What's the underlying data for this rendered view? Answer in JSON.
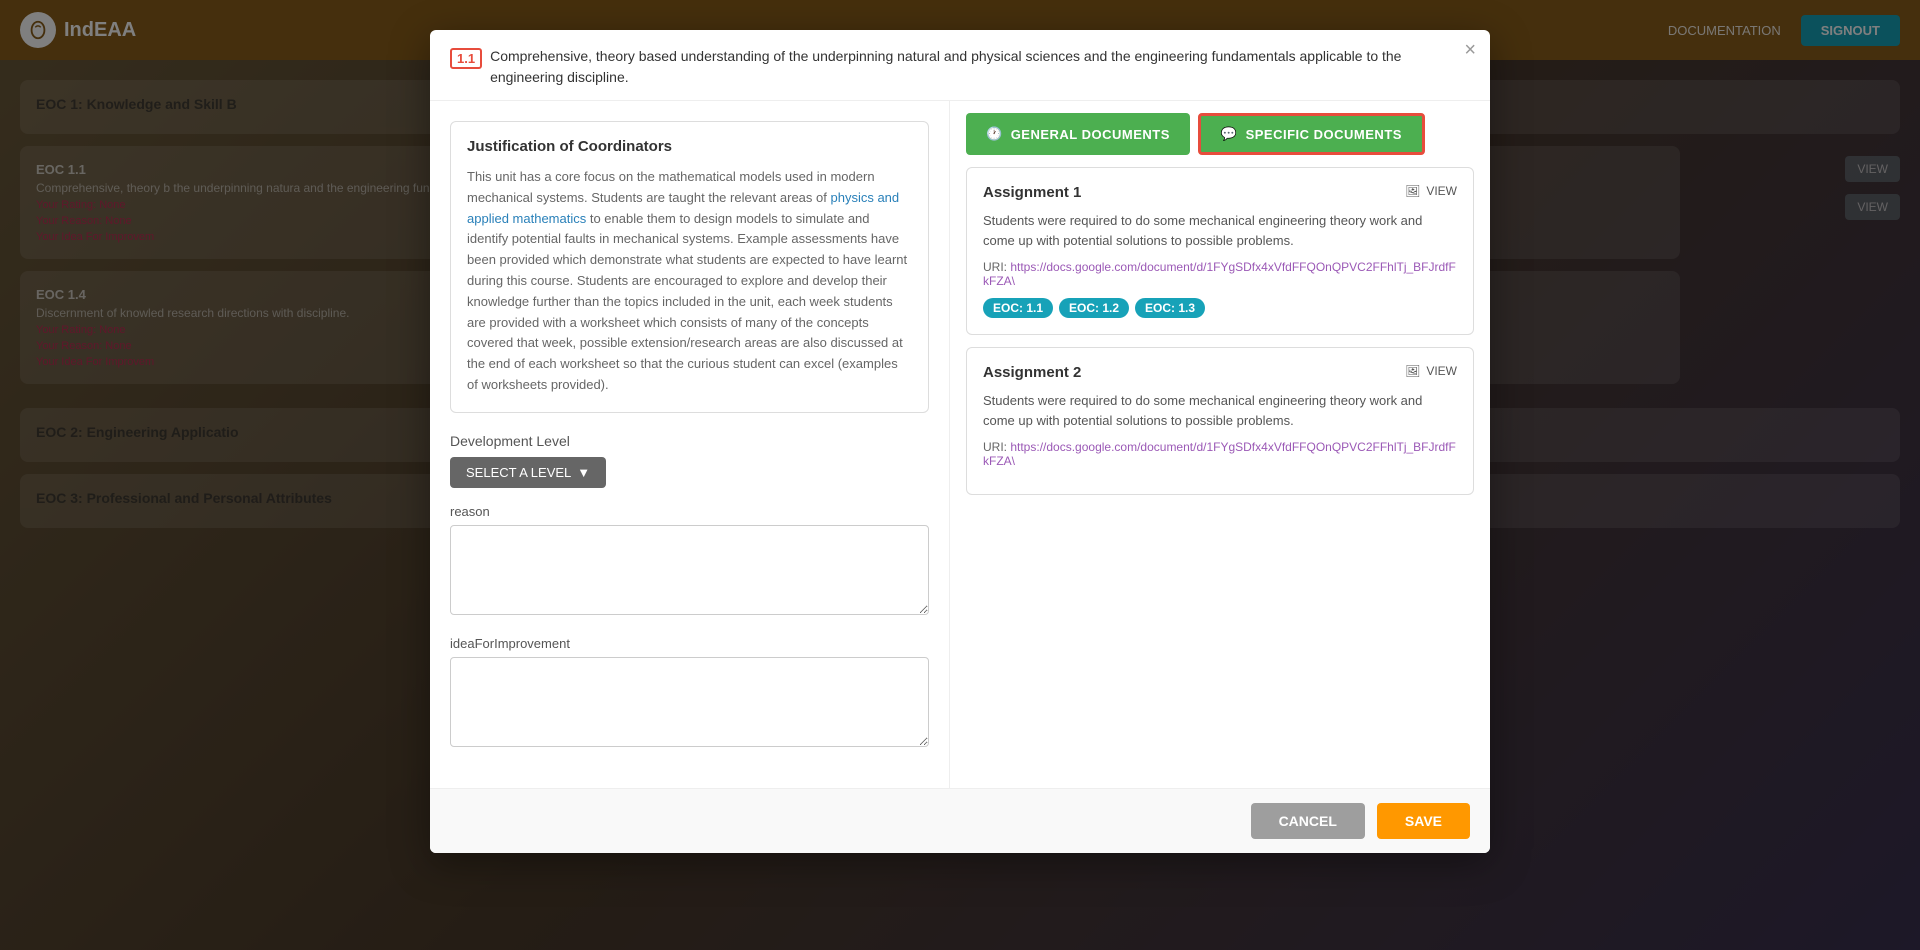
{
  "app": {
    "name": "IndEAA",
    "signout_label": "SIGNOUT",
    "documentation_label": "DOCUMENTATION"
  },
  "modal": {
    "eoc_badge": "1.1",
    "title_text": "Comprehensive, theory based understanding of the underpinning natural and physical sciences and the engineering fundamentals applicable to the engineering discipline.",
    "close_icon": "×",
    "left": {
      "justification_title": "Justification of Coordinators",
      "justification_text_1": "This unit has a core focus on the mathematical models used in modern mechanical systems. Students are taught the relevant areas of ",
      "justification_highlight_1": "physics and applied mathematics",
      "justification_text_2": " to enable them to design models to simulate and identify potential faults in mechanical systems. Example assessments have been provided which demonstrate what students are expected to have learnt during this course. Students are encouraged to explore and develop their knowledge further than the topics included in the unit, each week students are provided with a worksheet which consists of many of the concepts covered that week, possible extension/research areas are also discussed at the end of each worksheet so that the curious student can excel (examples of worksheets provided).",
      "dev_level_label": "Development Level",
      "select_level_btn": "SELECT A LEVEL",
      "reason_label": "reason",
      "idea_label": "ideaForImprovement"
    },
    "right": {
      "tab_general": "GENERAL DOCUMENTS",
      "tab_specific": "SPECIFIC DOCUMENTS",
      "assignments": [
        {
          "title": "Assignment 1",
          "view_label": "VIEW",
          "description": "Students were required to do some mechanical engineering theory work and come up with potential solutions to possible problems.",
          "uri_label": "URI:",
          "uri_text": "https://docs.google.com/document/d/1FYgSDfx4xVfdFFQOnQPVC2FFhlTj_BFJrdfFkFZA\\",
          "tags": [
            "EOC: 1.1",
            "EOC: 1.2",
            "EOC: 1.3"
          ]
        },
        {
          "title": "Assignment 2",
          "view_label": "VIEW",
          "description": "Students were required to do some mechanical engineering theory work and come up with potential solutions to possible problems.",
          "uri_label": "URI:",
          "uri_text": "https://docs.google.com/document/d/1FYgSDfx4xVfdFFQOnQPVC2FFhlTj_BFJrdfFkFZA\\",
          "tags": []
        }
      ]
    },
    "footer": {
      "cancel_label": "CANCEL",
      "save_label": "SAVE"
    }
  },
  "background": {
    "eoc1_title": "EOC 1: Knowledge and Skill B",
    "eoc_1_1_title": "EOC 1.1",
    "eoc_1_1_text": "Comprehensive, theory b the underpinning natura and the engineering fund the engineering discipli",
    "eoc_1_1_rating": "Your Rating: None",
    "eoc_1_1_reason": "Your Reason: None",
    "eoc_1_1_idea": "Your Idea For Improvem",
    "eoc_1_4_title": "EOC 1.4",
    "eoc_1_4_text": "Discernment of knowled research directions with discipline.",
    "eoc_1_4_rating": "Your Rating: None",
    "eoc_1_4_reason": "Your Reason: None",
    "eoc_1_4_idea": "Your Idea For Improvem",
    "eoc2_title": "EOC 2: Engineering Applicatio",
    "eoc3_title": "EOC 3: Professional and Personal Attributes",
    "view_label": "VIEW"
  }
}
